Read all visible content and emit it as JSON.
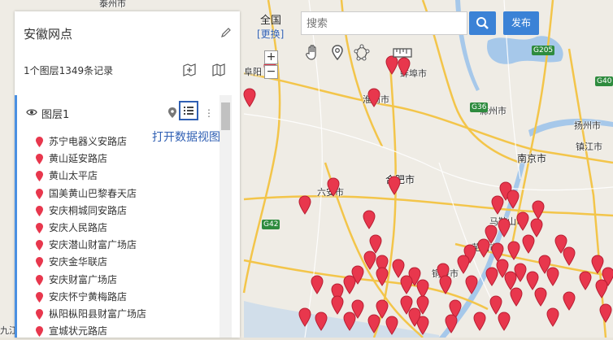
{
  "app": {
    "panel_title": "安徽网点",
    "stats": "1个图层1349条记录"
  },
  "layer": {
    "name": "图层1",
    "callout": "打开数据视图",
    "items": [
      "苏宁电器义安路店",
      "黄山延安路店",
      "黄山太平店",
      "国美黄山巴黎春天店",
      "安庆桐城同安路店",
      "安庆人民路店",
      "安庆潜山财富广场店",
      "安庆金华联店",
      "安庆财富广场店",
      "安庆怀宁黄梅路店",
      "枞阳枞阳县财富广场店",
      "宣城状元路店"
    ]
  },
  "search": {
    "placeholder": "搜索"
  },
  "toolbar": {
    "publish_label": "发布"
  },
  "map": {
    "region": "全国",
    "change_label": "[更换]",
    "zoom_in": "+",
    "zoom_out": "−",
    "labels": {
      "huainan": "淮南市",
      "chuzhou": "滁州市",
      "yangzhou": "扬州市",
      "zhenjiang": "镇江市",
      "nanjing": "南京市",
      "hefei": "合肥市",
      "liuan": "六安市",
      "maanshan": "马鞍山市",
      "tongling": "铜陵市",
      "top_city": "泰州市",
      "fuyang": "阜阳",
      "jiujiang": "九江",
      "bengbu": "蚌埠市",
      "wuhu": "芜湖市"
    },
    "highways": {
      "g205": "G205",
      "g36": "G36",
      "g42": "G42",
      "g40": "G40"
    }
  },
  "colors": {
    "accent": "#3b82d6",
    "pin": "#e8374d",
    "layer_bar": "#4a90e2",
    "callout": "#2f5fb3"
  }
}
